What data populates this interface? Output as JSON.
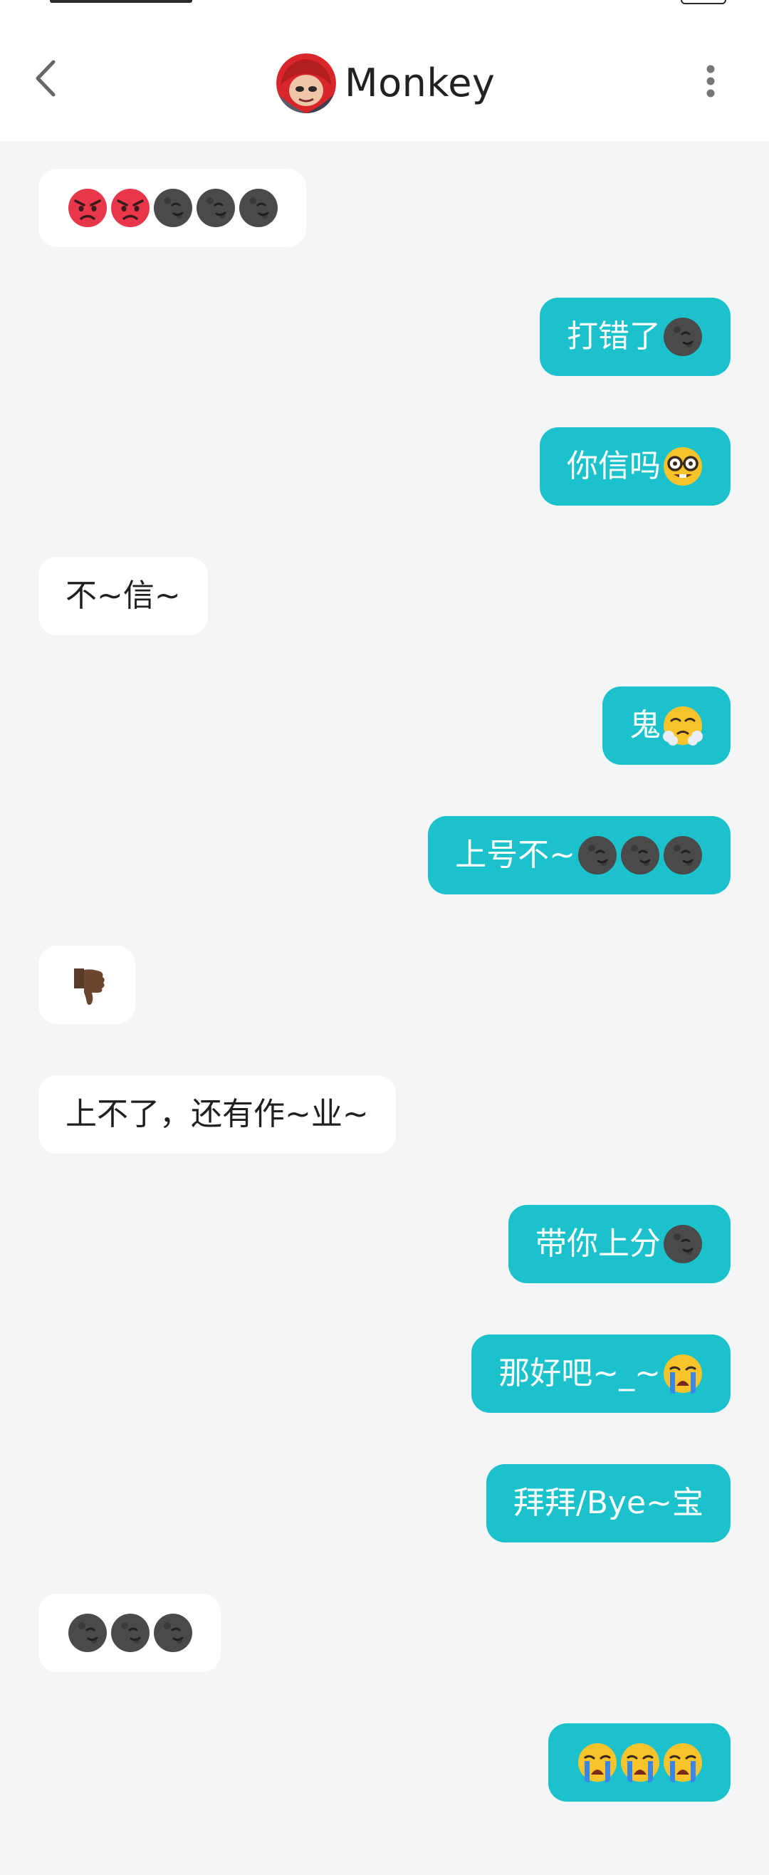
{
  "header": {
    "title": "Monkey",
    "back_icon": "chevron-left-icon",
    "more_icon": "more-vertical-icon",
    "avatar": "monkey-avatar"
  },
  "colors": {
    "sent_bubble": "#1bc2cc",
    "received_bubble": "#ffffff",
    "background": "#f4f5f7",
    "header_bg": "#ffffff"
  },
  "messages": [
    {
      "side": "received",
      "text": "",
      "emojis": [
        "angry-face",
        "angry-face",
        "new-moon-face",
        "new-moon-face",
        "new-moon-face"
      ]
    },
    {
      "side": "sent",
      "text": "打错了",
      "emojis": [
        "new-moon-face"
      ]
    },
    {
      "side": "sent",
      "text": "你信吗",
      "emojis": [
        "nerd-face"
      ]
    },
    {
      "side": "received",
      "text": "不~信~",
      "emojis": []
    },
    {
      "side": "sent",
      "text": "鬼",
      "emojis": [
        "steam-face"
      ]
    },
    {
      "side": "sent",
      "text": "上号不~",
      "emojis": [
        "new-moon-face",
        "new-moon-face",
        "new-moon-face"
      ]
    },
    {
      "side": "received",
      "text": "",
      "emojis": [
        "thumbs-down"
      ]
    },
    {
      "side": "received",
      "text": "上不了，还有作~业~",
      "emojis": []
    },
    {
      "side": "sent",
      "text": "带你上分",
      "emojis": [
        "new-moon-face"
      ]
    },
    {
      "side": "sent",
      "text": "那好吧~_~",
      "emojis": [
        "crying-face"
      ]
    },
    {
      "side": "sent",
      "text": "拜拜/Bye~宝",
      "emojis": []
    },
    {
      "side": "received",
      "text": "",
      "emojis": [
        "new-moon-face",
        "new-moon-face",
        "new-moon-face"
      ]
    },
    {
      "side": "sent",
      "text": "",
      "emojis": [
        "crying-face",
        "crying-face",
        "crying-face"
      ]
    }
  ]
}
